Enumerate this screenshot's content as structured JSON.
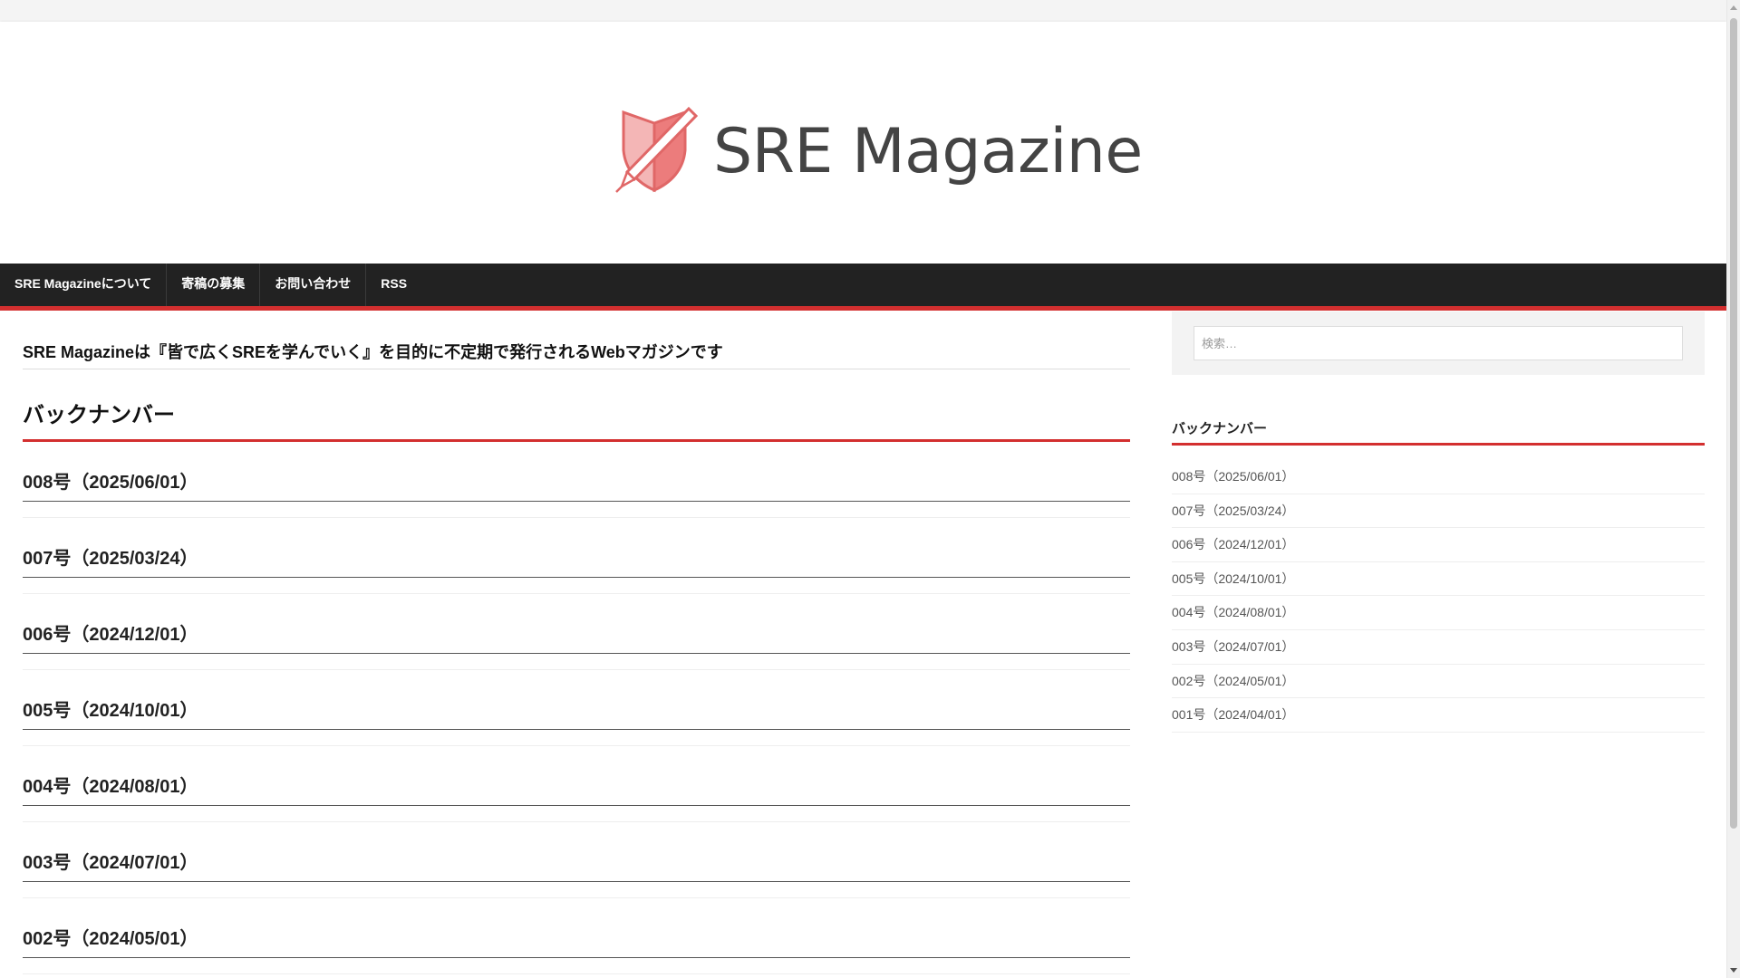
{
  "site": {
    "logo_text": "SRE Magazine",
    "accent_color": "#d32f2f"
  },
  "nav": {
    "items": [
      {
        "label": "SRE Magazineについて"
      },
      {
        "label": "寄稿の募集"
      },
      {
        "label": "お問い合わせ"
      },
      {
        "label": "RSS"
      }
    ]
  },
  "main": {
    "intro": "SRE Magazineは『皆で広くSREを学んでいく』を目的に不定期で発行されるWebマガジンです",
    "section_title": "バックナンバー",
    "issues": [
      {
        "title": "008号（2025/06/01）"
      },
      {
        "title": "007号（2025/03/24）"
      },
      {
        "title": "006号（2024/12/01）"
      },
      {
        "title": "005号（2024/10/01）"
      },
      {
        "title": "004号（2024/08/01）"
      },
      {
        "title": "003号（2024/07/01）"
      },
      {
        "title": "002号（2024/05/01）"
      }
    ]
  },
  "sidebar": {
    "search_placeholder": "検索…",
    "widget_title": "バックナンバー",
    "items": [
      {
        "label": "008号（2025/06/01）"
      },
      {
        "label": "007号（2025/03/24）"
      },
      {
        "label": "006号（2024/12/01）"
      },
      {
        "label": "005号（2024/10/01）"
      },
      {
        "label": "004号（2024/08/01）"
      },
      {
        "label": "003号（2024/07/01）"
      },
      {
        "label": "002号（2024/05/01）"
      },
      {
        "label": "001号（2024/04/01）"
      }
    ]
  }
}
